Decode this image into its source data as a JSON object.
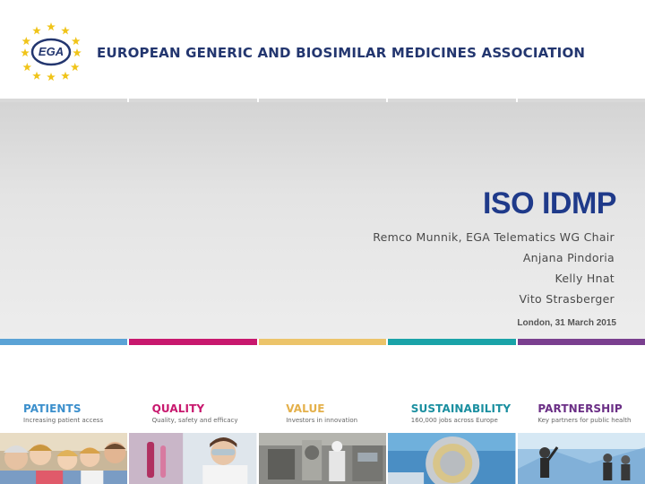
{
  "header": {
    "logo_text": "EGA",
    "org_name": "EUROPEAN GENERIC AND BIOSIMILAR MEDICINES ASSOCIATION"
  },
  "slide": {
    "title": "ISO IDMP",
    "authors": [
      "Remco Munnik, EGA Telematics WG Chair",
      "Anjana Pindoria",
      "Kelly Hnat",
      "Vito Strasberger"
    ],
    "date": "London, 31 March 2015"
  },
  "colors": {
    "stripe": [
      "#5ba3d6",
      "#c8186e",
      "#ecc46a",
      "#1aa3a8",
      "#7a3f8f"
    ],
    "title": "#1f3a8a",
    "org_name": "#23366f"
  },
  "pillars": [
    {
      "title": "PATIENTS",
      "subtitle": "Increasing patient access",
      "color": "#3b8fcc",
      "image": "family-photo"
    },
    {
      "title": "QUALITY",
      "subtitle": "Quality, safety and efficacy",
      "color": "#c8186e",
      "image": "lab-scientist-photo"
    },
    {
      "title": "VALUE",
      "subtitle": "Investors in innovation",
      "color": "#e4b04a",
      "image": "manufacturing-photo"
    },
    {
      "title": "SUSTAINABILITY",
      "subtitle": "160,000 jobs across Europe",
      "color": "#1a8fa0",
      "image": "euro-coin-photo"
    },
    {
      "title": "PARTNERSHIP",
      "subtitle": "Key partners for public health",
      "color": "#6b2f86",
      "image": "business-people-photo"
    }
  ]
}
